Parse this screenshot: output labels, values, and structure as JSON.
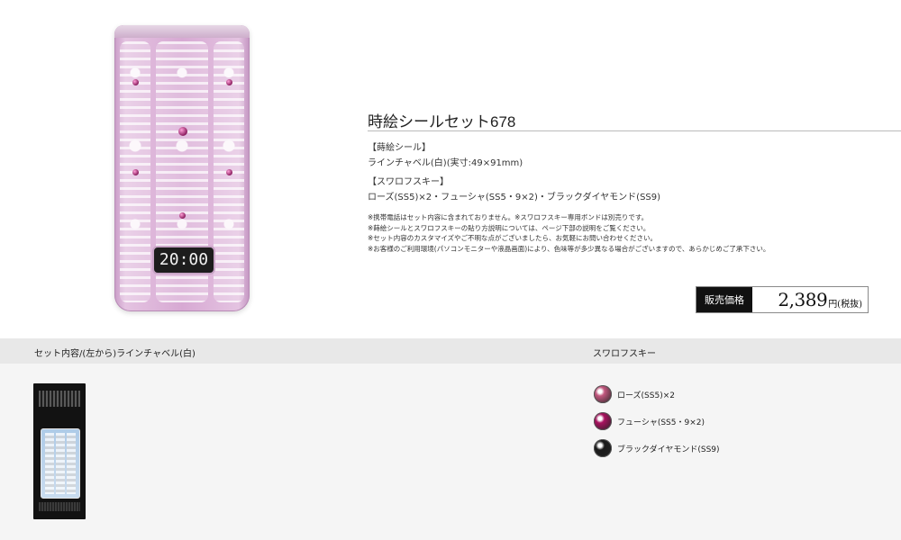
{
  "phone": {
    "clock_time": "20:00"
  },
  "product": {
    "title": "時絵シールセット678",
    "sticker_heading": "【蒔絵シール】",
    "sticker_detail": "ラインチャベル(白)(実寸:49×91mm)",
    "swarovski_heading": "【スワロフスキー】",
    "swarovski_detail": "ローズ(SS5)×2・フューシャ(SS5・9×2)・ブラックダイヤモンド(SS9)",
    "notes": [
      "※携帯電話はセット内容に含まれておりません。※スワロフスキー専用ボンドは別売りです。",
      "※蒔絵シールとスワロフスキーの貼り方説明については、ページ下部の説明をご覧ください。",
      "※セット内容のカスタマイズやご不明な点がございましたら、お気軽にお問い合わせください。",
      "※お客様のご利用環境(パソコンモニターや液晶画面)により、色味等が多少異なる場合がございますので、あらかじめご了承下さい。"
    ]
  },
  "price": {
    "label": "販売価格",
    "value": "2,389",
    "unit": "円(税抜)"
  },
  "contents": {
    "left_heading": "セット内容/(左から)ラインチャベル(白)",
    "right_heading": "スワロフスキー",
    "stones": [
      {
        "label": "ローズ(SS5)×2",
        "color": "#c2577e"
      },
      {
        "label": "フューシャ(SS5・9×2)",
        "color": "#a8125f"
      },
      {
        "label": "ブラックダイヤモンド(SS9)",
        "color": "#1a1a1a"
      }
    ]
  },
  "colors": {
    "phone_body": "#d7a9d3",
    "price_label_bg": "#111111",
    "band_bg": "#e8e8e8"
  }
}
